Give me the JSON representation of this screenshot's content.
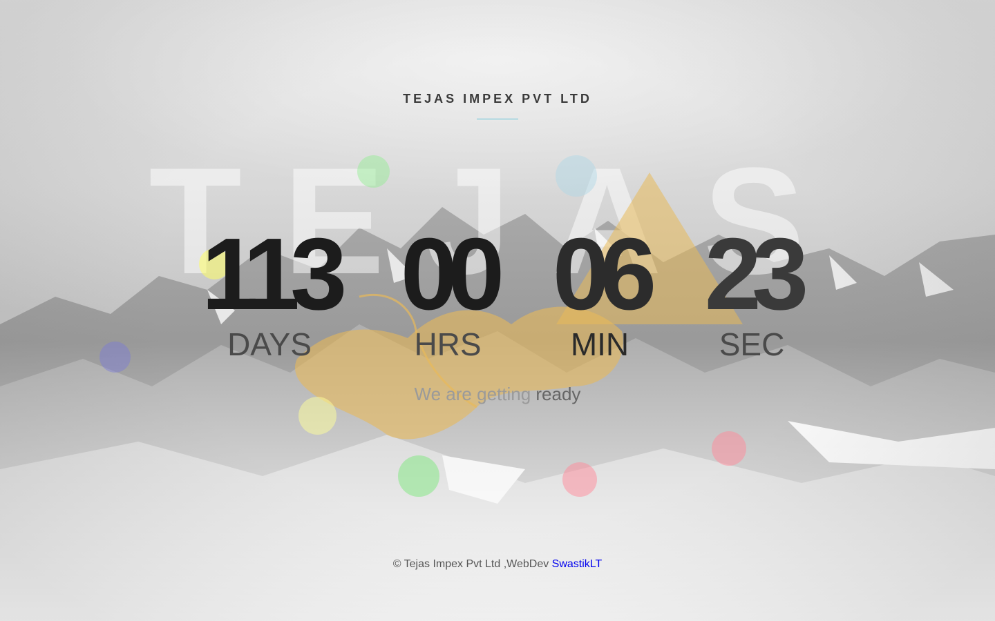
{
  "header": {
    "company": "TEJAS IMPEX PVT LTD",
    "watermark": "TEJAS"
  },
  "countdown": [
    {
      "value": "113",
      "label": "DAYS"
    },
    {
      "value": "00",
      "label": "HRS"
    },
    {
      "value": "06",
      "label": "MIN"
    },
    {
      "value": "23",
      "label": "SEC"
    }
  ],
  "tagline": {
    "prefix": "We are getting ",
    "emphasis": "ready"
  },
  "footer": {
    "copyright": "© Tejas Impex Pvt Ltd ,WebDev ",
    "link_label": "SwastikLT"
  },
  "colors": {
    "accent_rule": "#5bc0d6",
    "logo_gold": "#e8b95a",
    "link": "#0000ee",
    "dots": [
      "#90ee90",
      "#add8e6",
      "#ffff66",
      "#7b7bd6",
      "#ffff99",
      "#7ee87e",
      "#ff8a99",
      "#ff8a99"
    ]
  }
}
